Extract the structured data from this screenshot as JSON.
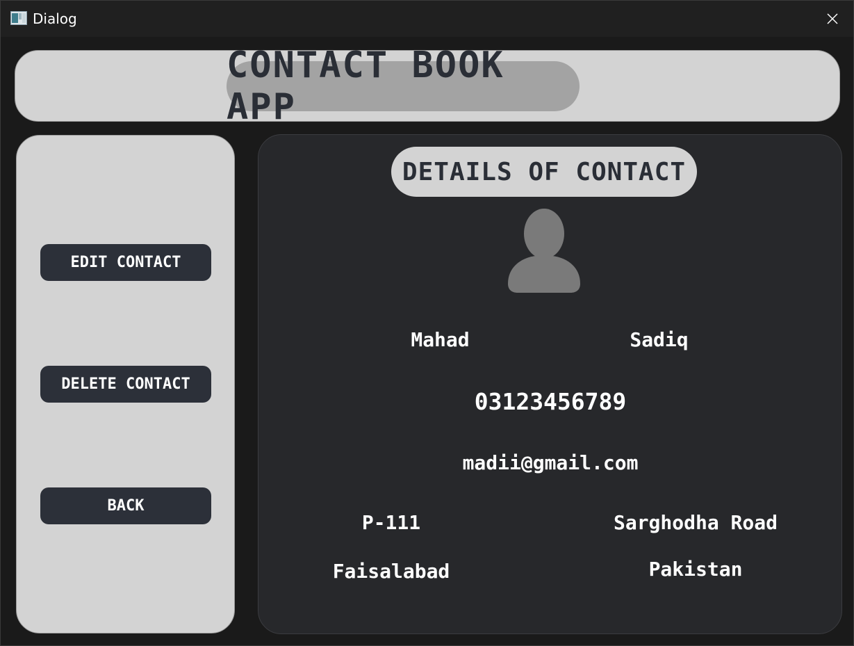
{
  "window": {
    "title": "Dialog"
  },
  "header": {
    "title": "CONTACT BOOK APP"
  },
  "sidebar": {
    "edit_label": "EDIT CONTACT",
    "delete_label": "DELETE CONTACT",
    "back_label": "BACK"
  },
  "details": {
    "title": "DETAILS OF CONTACT",
    "first_name": "Mahad",
    "last_name": "Sadiq",
    "phone": "03123456789",
    "email": "madii@gmail.com",
    "house": "P-111",
    "street": "Sarghodha Road",
    "city": "Faisalabad",
    "country": "Pakistan"
  },
  "icons": {
    "app": "app-icon",
    "close": "close-icon",
    "avatar": "user-avatar-icon"
  },
  "colors": {
    "panel_light": "#d3d3d3",
    "panel_dark": "#27282b",
    "button": "#2c3039",
    "header_pill": "#a3a3a3",
    "text_dark": "#2a2e36",
    "avatar": "#7a7a7a"
  }
}
